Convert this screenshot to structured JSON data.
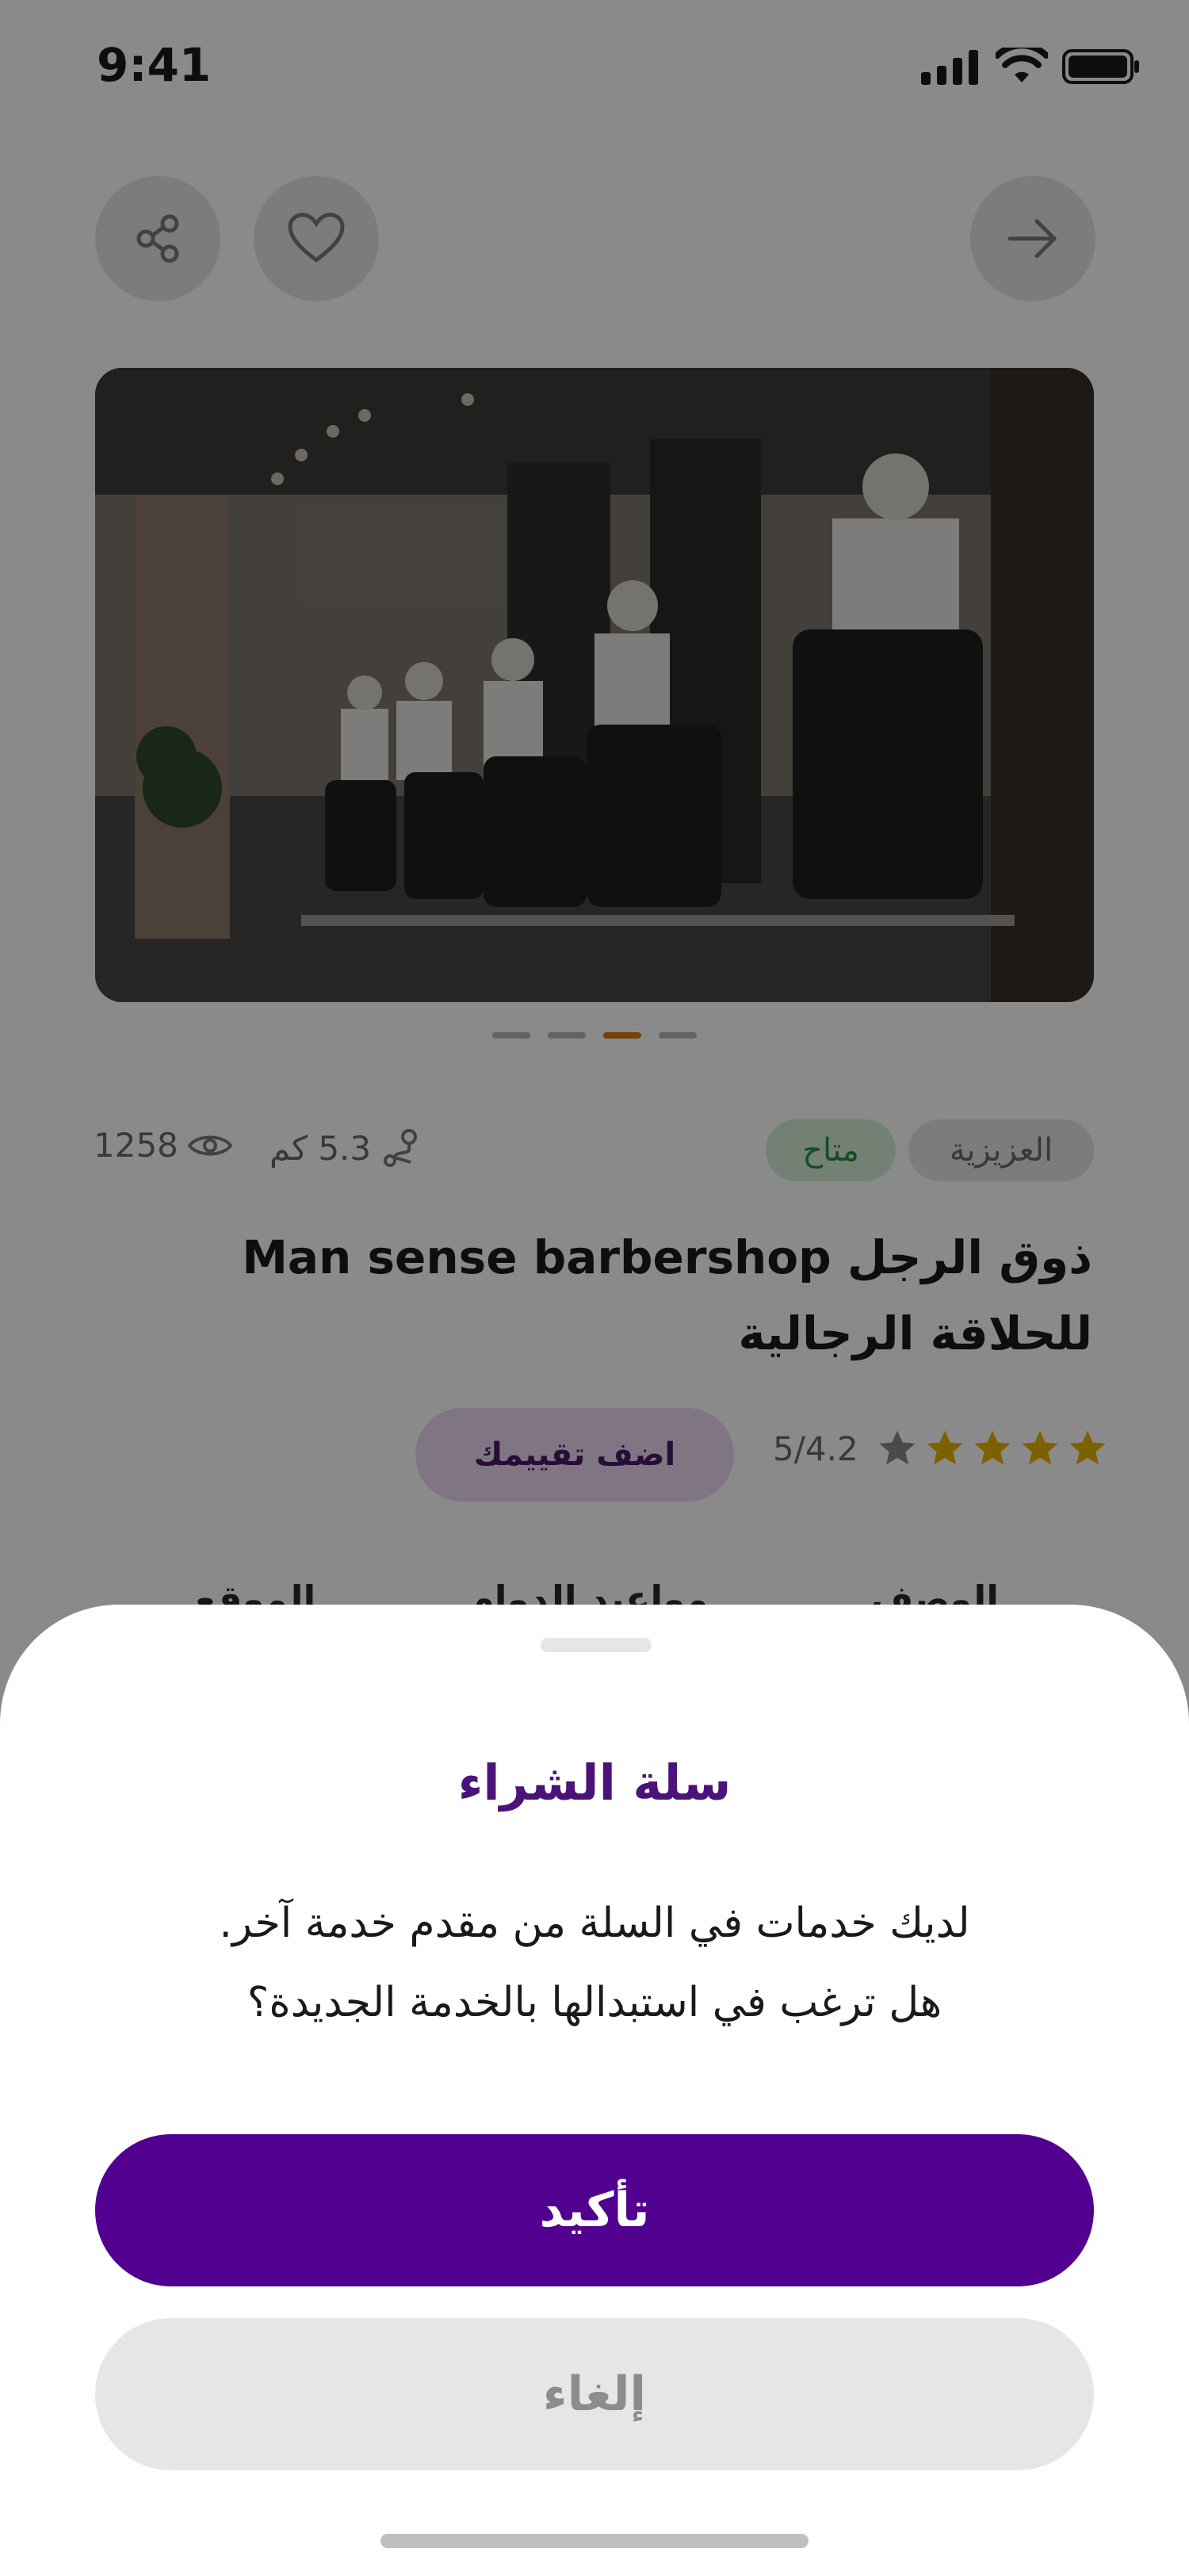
{
  "status_bar": {
    "time": "9:41"
  },
  "header": {
    "share_icon": "share-icon",
    "favorite_icon": "heart-icon",
    "back_icon": "arrow-right-icon"
  },
  "gallery": {
    "image_alt": "barbershop interior with barbers",
    "dots_count": 4,
    "active_dot_index": 2
  },
  "shop": {
    "district": "العزيزية",
    "availability": "متاح",
    "distance": "5.3 كم",
    "views": "1258",
    "name": "ذوق الرجل Man sense barbershop للحلاقة الرجالية",
    "rating_text": "5/4.2",
    "rating_value": 4.2,
    "rating_max": 5,
    "add_rating_label": "اضف تقييمك"
  },
  "tabs": [
    {
      "label": "الوصف"
    },
    {
      "label": "مواعيد الدوام"
    },
    {
      "label": "الموقع"
    }
  ],
  "sheet": {
    "title": "سلة الشراء",
    "message_line1": "لديك خدمات في السلة من مقدم خدمة آخر.",
    "message_line2": "هل ترغب في استبدالها بالخدمة الجديدة؟",
    "confirm_label": "تأكيد",
    "cancel_label": "إلغاء"
  },
  "colors": {
    "primary": "#520090",
    "title_purple": "#4b1279",
    "active_dot": "#d57d10",
    "star": "#e8b400",
    "available_green": "#2e8b3e"
  }
}
